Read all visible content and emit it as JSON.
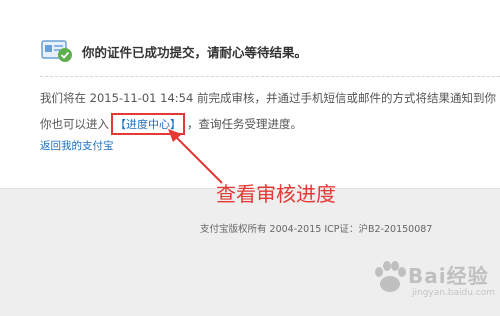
{
  "card": {
    "title": "你的证件已成功提交，请耐心等待结果。",
    "line1_prefix": "我们将在 ",
    "timestamp": "2015-11-01 14:54",
    "line1_suffix": " 前完成审核，并通过手机短信或邮件的方式将结果通知到你",
    "line2_prefix": "你也可以进入",
    "progress_link": "【进度中心】",
    "line2_suffix": "，查询任务受理进度。",
    "back_link": "返回我的支付宝"
  },
  "annotation": "查看审核进度",
  "footer": "支付宝版权所有 2004-2015 ICP证：沪B2-20150087",
  "watermark": {
    "text": "Bai经验",
    "url": "jingyan.baidu.com"
  },
  "colors": {
    "link": "#1a6fc2",
    "annotation": "#e53935",
    "success": "#5fae4f",
    "card_icon": "#6aa0d8"
  }
}
